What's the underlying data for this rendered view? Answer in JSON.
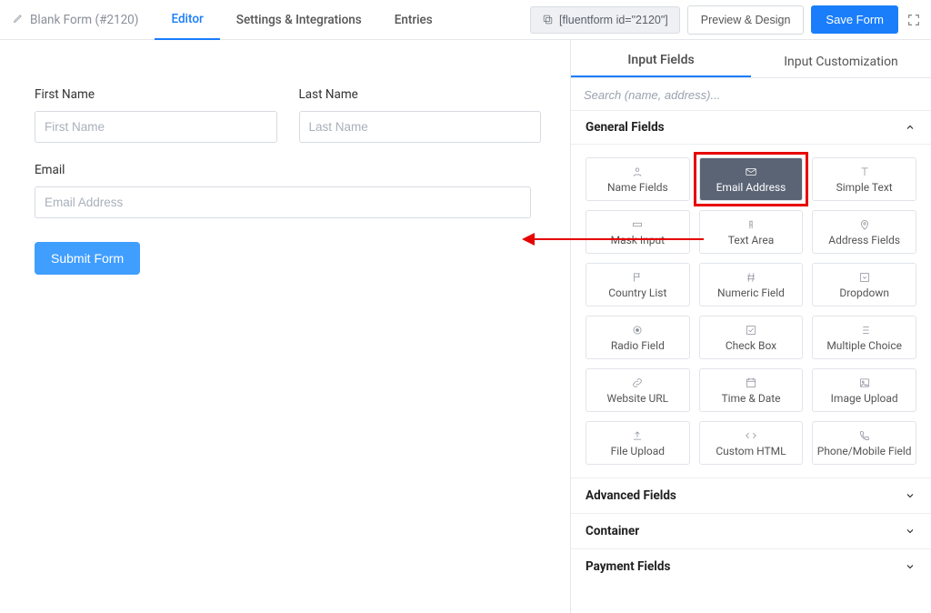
{
  "form_name": "Blank Form (#2120)",
  "nav": {
    "editor": "Editor",
    "settings": "Settings & Integrations",
    "entries": "Entries"
  },
  "shortcode": "[fluentform id=\"2120\"]",
  "buttons": {
    "preview": "Preview & Design",
    "save": "Save Form",
    "submit": "Submit Form"
  },
  "labels": {
    "first_name": "First Name",
    "last_name": "Last Name",
    "email": "Email"
  },
  "placeholders": {
    "first_name": "First Name",
    "last_name": "Last Name",
    "email": "Email Address",
    "search": "Search (name, address)..."
  },
  "side": {
    "tab_input": "Input Fields",
    "tab_custom": "Input Customization"
  },
  "sections": {
    "general": "General Fields",
    "advanced": "Advanced Fields",
    "container": "Container",
    "payment": "Payment Fields"
  },
  "fields": {
    "name": "Name Fields",
    "email": "Email Address",
    "simple": "Simple Text",
    "mask": "Mask Input",
    "textarea": "Text Area",
    "address": "Address Fields",
    "country": "Country List",
    "numeric": "Numeric Field",
    "dropdown": "Dropdown",
    "radio": "Radio Field",
    "checkbox": "Check Box",
    "multi": "Multiple Choice",
    "url": "Website URL",
    "date": "Time & Date",
    "image": "Image Upload",
    "file": "File Upload",
    "html": "Custom HTML",
    "phone": "Phone/Mobile Field"
  }
}
